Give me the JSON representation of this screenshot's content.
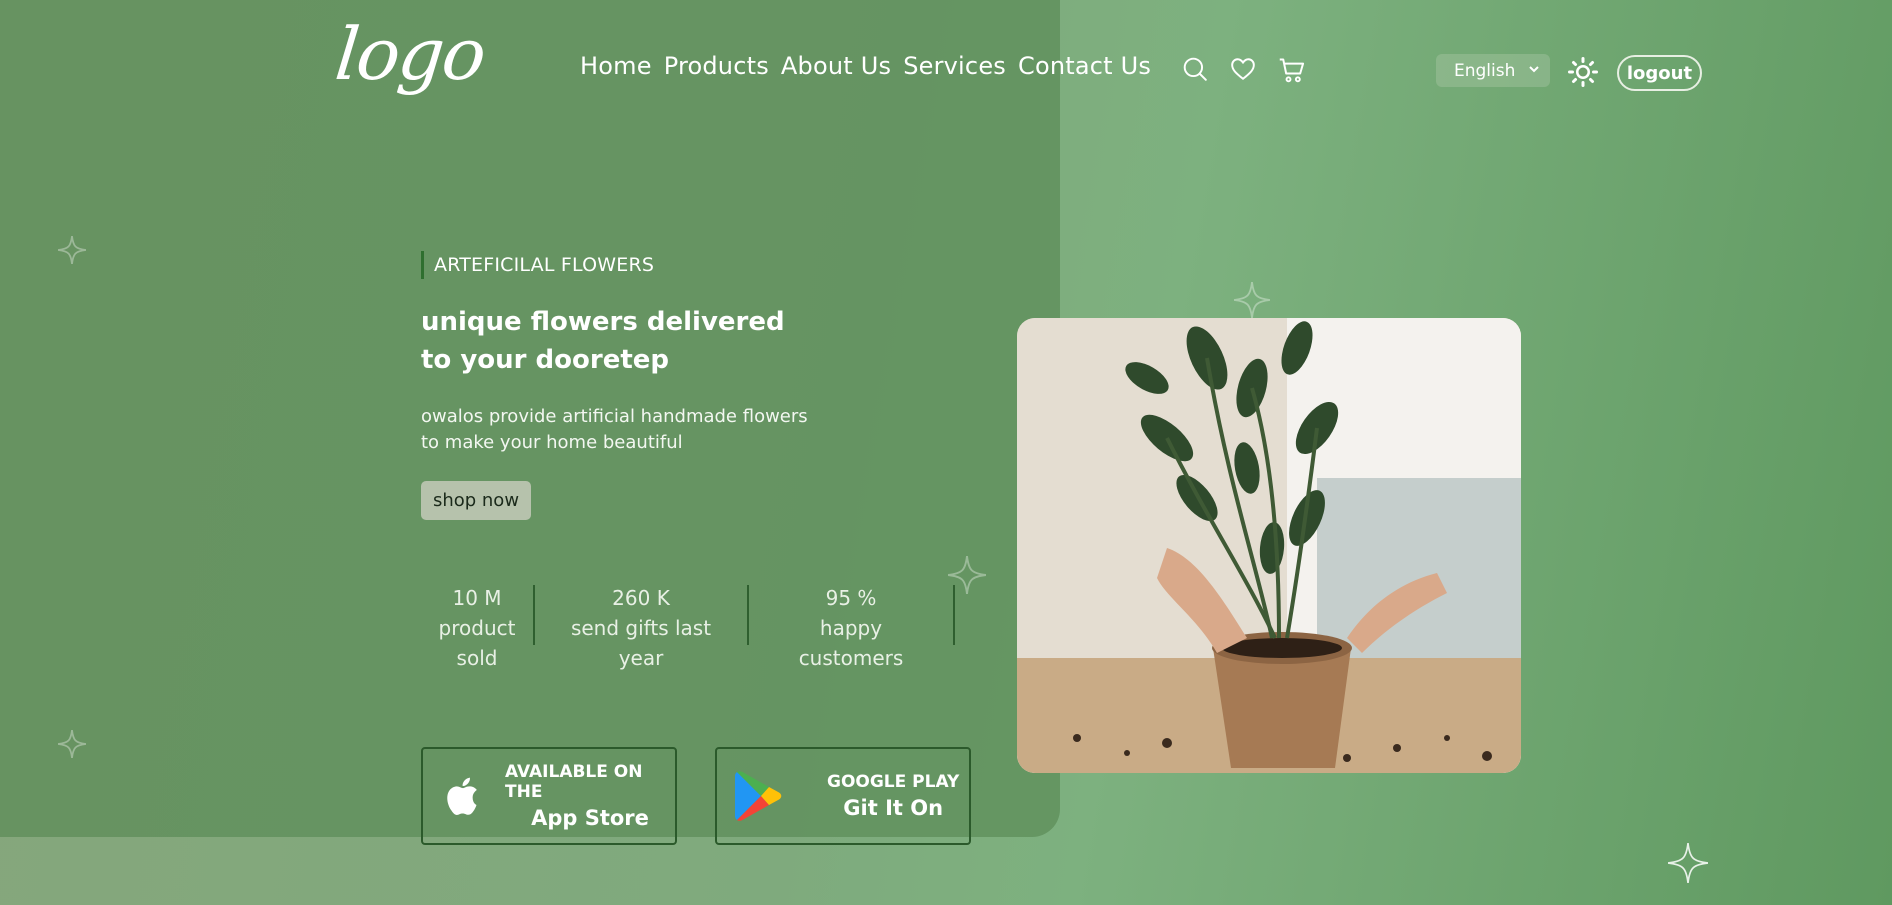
{
  "brand": {
    "logo_text": "logo"
  },
  "nav": {
    "items": [
      "Home",
      "Products",
      "About Us",
      "Services",
      "Contact Us"
    ]
  },
  "header": {
    "icons": [
      "search-icon",
      "heart-icon",
      "cart-icon"
    ],
    "language": "English",
    "theme_icon": "sun-icon",
    "logout_label": "logout"
  },
  "hero": {
    "eyebrow": "ARTEFICILAL FLOWERS",
    "headline_line1": "unique flowers delivered",
    "headline_line2": "to your dooretep",
    "desc_line1": "owalos provide artificial handmade flowers",
    "desc_line2": "to make your home beautiful",
    "cta_label": "shop now"
  },
  "stats": [
    {
      "value": "10 M",
      "label_line1": "product",
      "label_line2": "sold"
    },
    {
      "value": "260 K",
      "label_line1": "send gifts last",
      "label_line2": "year"
    },
    {
      "value": "95 %",
      "label_line1": "happy",
      "label_line2": "customers"
    }
  ],
  "stores": {
    "apple": {
      "top": "AVAILABLE ON THE",
      "bottom": "App Store"
    },
    "google": {
      "top": "GOOGLE PLAY",
      "bottom": "Git It On"
    }
  },
  "colors": {
    "background": "#7faa7d",
    "panel": "#5c8c58",
    "accent_dark": "#2b5a2b",
    "button": "#b6c2ac"
  }
}
